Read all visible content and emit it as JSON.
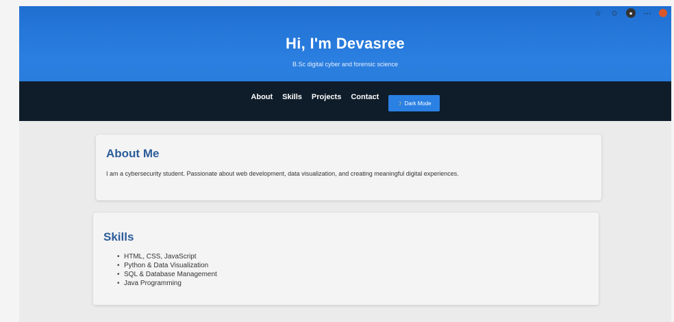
{
  "header": {
    "title": "Hi, I'm Devasree",
    "subtitle": "B.Sc digital cyber and forensic science"
  },
  "nav": {
    "items": [
      "About",
      "Skills",
      "Projects",
      "Contact"
    ],
    "dark_mode_label": "Dark Mode"
  },
  "about": {
    "heading": "About Me",
    "text": "I am a cybersecurity student. Passionate about web development, data visualization, and creating meaningful digital experiences."
  },
  "skills": {
    "heading": "Skills",
    "items": [
      "HTML, CSS, JavaScript",
      "Python & Data Visualization",
      "SQL & Database Management",
      "Java Programming"
    ]
  },
  "colors": {
    "header_blue": "#2b7fe0",
    "nav_dark": "#0f1d2a",
    "heading_blue": "#2c5c9a",
    "button_blue": "#2a80e3"
  },
  "icons": [
    "star-icon",
    "bookmark-star-icon",
    "extension-icon",
    "more-icon",
    "profile-icon",
    "moon-icon"
  ]
}
